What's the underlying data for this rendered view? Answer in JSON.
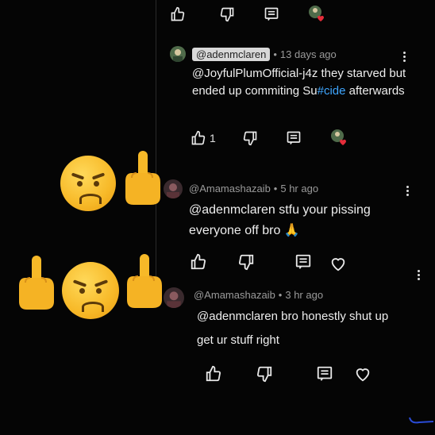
{
  "comments": [
    {
      "author": "@adenmclaren",
      "time": "13 days ago",
      "text_mention": "@JoyfulPlumOfficial-j4z",
      "text_before_tag": "they starved but ended up commiting Su",
      "hashtag": "#cide",
      "text_after_tag": "afterwards",
      "likes": "1"
    },
    {
      "author": "@Amamashazaib",
      "time": "5 hr ago",
      "text": "@adenmclaren stfu your pissing everyone off bro",
      "emoji": "🙏"
    },
    {
      "author": "@Amamashazaib",
      "time": "3 hr ago",
      "text": "@adenmclaren bro honestly shut up get ur stuff right"
    }
  ],
  "separators": {
    "dot": "•"
  },
  "icons": [
    "thumb-up-icon",
    "thumb-down-icon",
    "reply-icon",
    "creator-heart-icon",
    "heart-icon",
    "more-icon",
    "angry-face-emoji",
    "middle-finger-emoji"
  ],
  "colors": {
    "background": "#050505",
    "text": "#eeeeee",
    "meta": "#9a9a9a",
    "hashtag": "#3ea6ff",
    "emoji": "#f7b928"
  }
}
